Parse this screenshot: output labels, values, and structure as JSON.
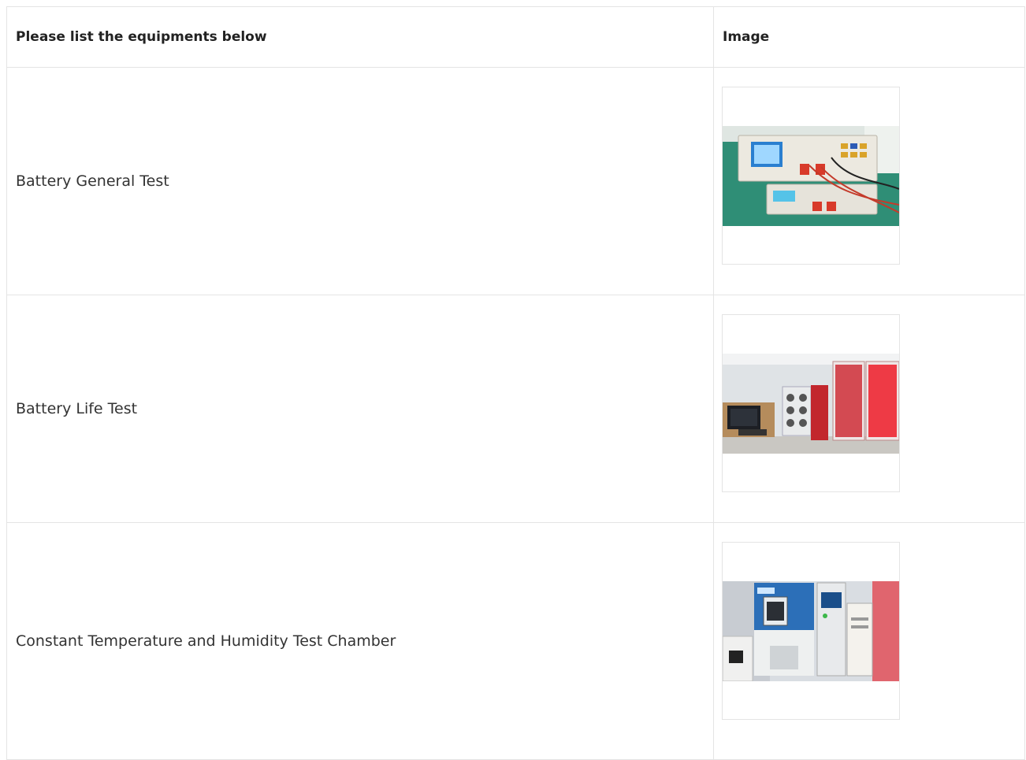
{
  "table": {
    "header": {
      "col1": "Please list the equipments below",
      "col2": "Image"
    },
    "rows": [
      {
        "name": "Battery General Test",
        "image_icon": "battery-tester-photo"
      },
      {
        "name": "Battery Life Test",
        "image_icon": "battery-life-rack-photo"
      },
      {
        "name": "Constant Temperature and Humidity Test Chamber",
        "image_icon": "climate-chamber-photo"
      }
    ]
  }
}
